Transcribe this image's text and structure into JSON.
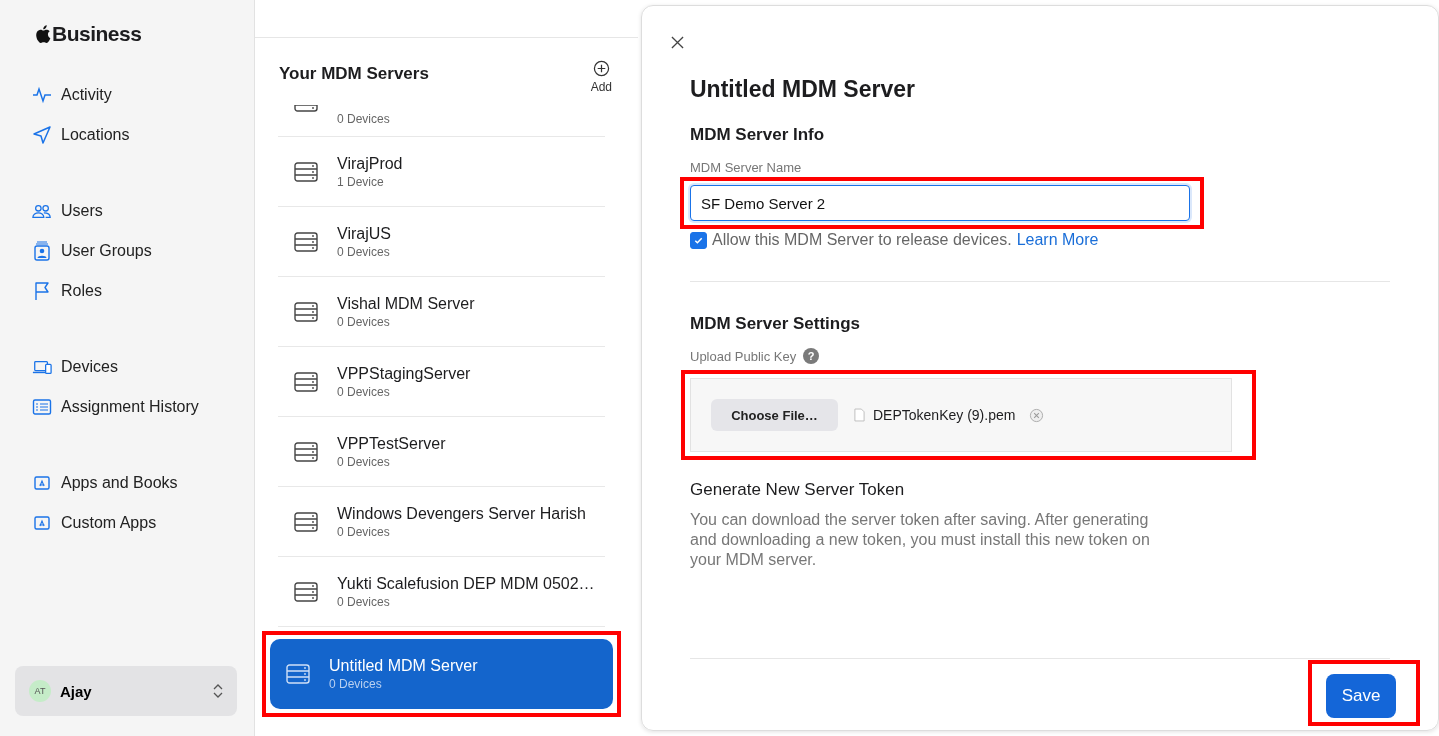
{
  "brand": {
    "name": "Business"
  },
  "sidebar": {
    "groups": [
      [
        {
          "label": "Activity",
          "kind": "activity"
        },
        {
          "label": "Locations",
          "kind": "location"
        }
      ],
      [
        {
          "label": "Users",
          "kind": "users"
        },
        {
          "label": "User Groups",
          "kind": "usergroup"
        },
        {
          "label": "Roles",
          "kind": "flag"
        }
      ],
      [
        {
          "label": "Devices",
          "kind": "devices"
        },
        {
          "label": "Assignment History",
          "kind": "list"
        }
      ],
      [
        {
          "label": "Apps and Books",
          "kind": "app"
        },
        {
          "label": "Custom Apps",
          "kind": "app"
        }
      ]
    ],
    "account": {
      "initials": "AT",
      "name": "Ajay"
    }
  },
  "servers": {
    "title": "Your MDM Servers",
    "add_label": "Add",
    "items": [
      {
        "count": "0 Devices",
        "selected": false,
        "highlighted": false
      },
      {
        "name": "VirajProd",
        "count": "1 Device",
        "selected": false,
        "highlighted": false
      },
      {
        "name": "VirajUS",
        "count": "0 Devices",
        "selected": false,
        "highlighted": false
      },
      {
        "name": "Vishal MDM Server",
        "count": "0 Devices",
        "selected": false,
        "highlighted": false
      },
      {
        "name": "VPPStagingServer",
        "count": "0 Devices",
        "selected": false,
        "highlighted": false
      },
      {
        "name": "VPPTestServer",
        "count": "0 Devices",
        "selected": false,
        "highlighted": false
      },
      {
        "name": "Windows Devengers Server Harish",
        "count": "0 Devices",
        "selected": false,
        "highlighted": false
      },
      {
        "name": "Yukti Scalefusion DEP MDM 0502…",
        "count": "0 Devices",
        "selected": false,
        "highlighted": false
      },
      {
        "name": "Untitled MDM Server",
        "count": "0 Devices",
        "selected": true,
        "highlighted": true
      }
    ]
  },
  "detail": {
    "title": "Untitled MDM Server",
    "info_heading": "MDM Server Info",
    "name_field": {
      "label": "MDM Server Name",
      "value": "SF Demo Server 2",
      "highlighted": true
    },
    "release_checkbox": {
      "label": "Allow this MDM Server to release devices.",
      "link": "Learn More",
      "checked": true
    },
    "settings_heading": "MDM Server Settings",
    "upload": {
      "label": "Upload Public Key",
      "help": "?",
      "button": "Choose File…",
      "file_name": "DEPTokenKey (9).pem",
      "highlighted": true
    },
    "token_heading": "Generate New Server Token",
    "token_text": "You can download the server token after saving. After generating and downloading a new token, you must install this new token on your MDM server.",
    "save_button": {
      "label": "Save",
      "highlighted": true
    }
  }
}
